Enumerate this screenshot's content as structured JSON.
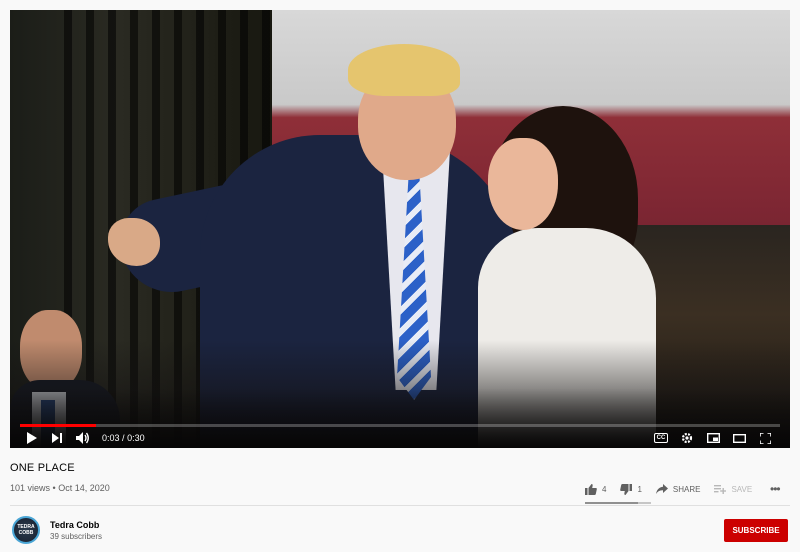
{
  "video": {
    "current_time": "0:03",
    "separator": "/",
    "duration": "0:30",
    "progress_fraction": 0.1
  },
  "controls": {
    "play_icon": "play-icon",
    "next_icon": "next-icon",
    "volume_icon": "volume-icon",
    "cc_label": "CC",
    "settings_icon": "gear-icon",
    "miniplayer_icon": "miniplayer-icon",
    "theater_icon": "theater-icon",
    "fullscreen_icon": "fullscreen-icon"
  },
  "info": {
    "title": "ONE PLACE",
    "views": "101 views",
    "dot": "•",
    "date": "Oct 14, 2020"
  },
  "actions": {
    "likes": "4",
    "dislikes": "1",
    "share": "SHARE",
    "save": "SAVE",
    "more": "•••",
    "like_ratio": 0.8
  },
  "channel": {
    "name": "Tedra Cobb",
    "subscribers": "39 subscribers",
    "avatar_line1": "TEDRA",
    "avatar_line2": "COBB",
    "subscribe_label": "SUBSCRIBE"
  },
  "colors": {
    "accent": "#cc0000",
    "progress": "#ff0000"
  }
}
